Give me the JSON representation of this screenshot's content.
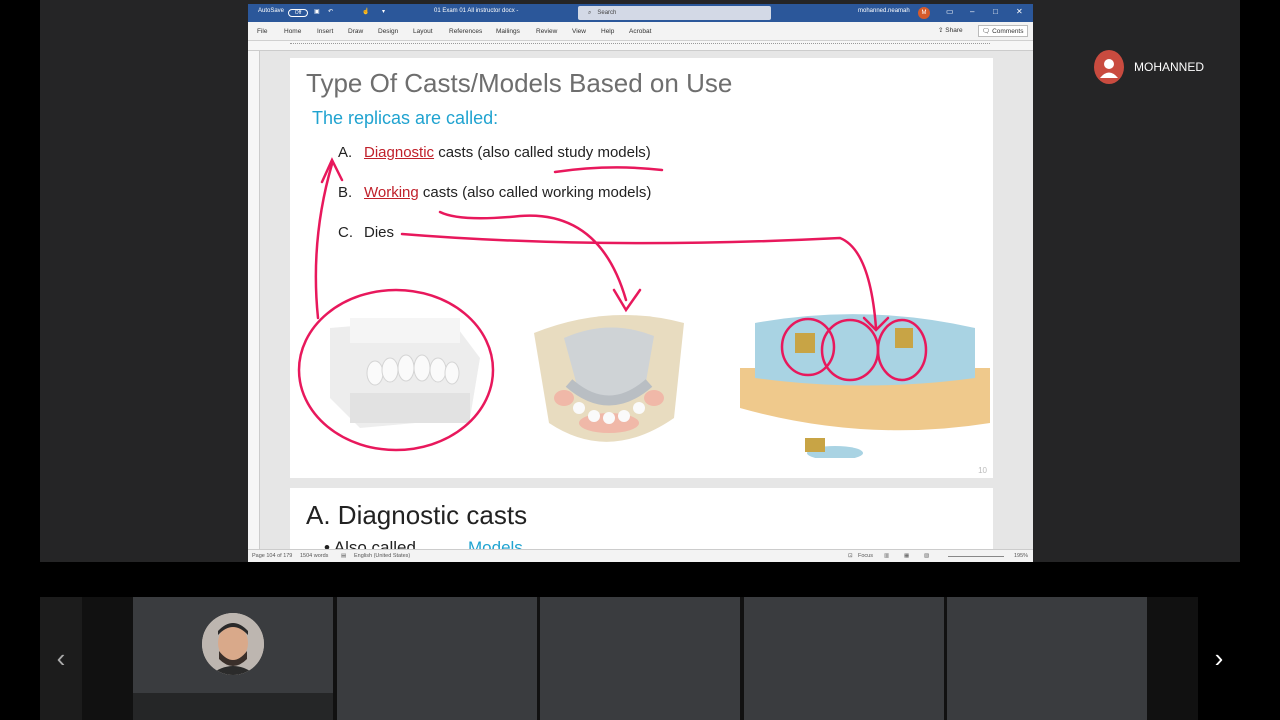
{
  "word": {
    "autosave_label": "AutoSave",
    "autosave_state": "Off",
    "doc_title": "01 Exam 01 All instructor docx  -",
    "search_placeholder": "Search",
    "user_name": "mohanned.neamah",
    "user_initial": "M",
    "menu": [
      "File",
      "Home",
      "Insert",
      "Draw",
      "Design",
      "Layout",
      "References",
      "Mailings",
      "Review",
      "View",
      "Help",
      "Acrobat"
    ],
    "share_label": "Share",
    "comments_label": "Comments",
    "status": {
      "page": "Page 104 of 179",
      "words": "1504 words",
      "language": "English (United States)",
      "focus": "Focus",
      "zoom": "195%"
    }
  },
  "slide": {
    "title": "Type Of Casts/Models Based on Use",
    "subtitle": "The replicas are called:",
    "items": [
      {
        "letter": "A.",
        "highlight": "Diagnostic",
        "rest": " casts (also called study models)"
      },
      {
        "letter": "B.",
        "highlight": "Working",
        "rest": " casts (also called working models)"
      },
      {
        "letter": "C.",
        "highlight": "",
        "rest": "Dies"
      }
    ],
    "page_number": "10"
  },
  "next_page": {
    "heading": "A. Diagnostic casts",
    "bullet_start": "• Also called",
    "bullet_end": "Models"
  },
  "presenter": {
    "name": "MOHANNED"
  },
  "colors": {
    "word_blue": "#2b579a",
    "ink_pink": "#e8185c",
    "subtitle_blue": "#20a3d0"
  }
}
